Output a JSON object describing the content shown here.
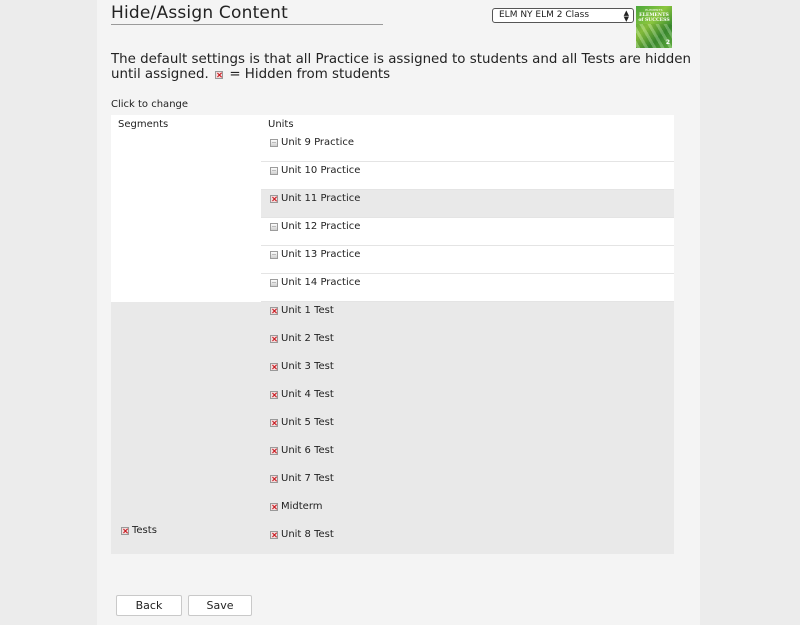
{
  "header": {
    "title": "Hide/Assign Content",
    "class_select": "ELM NY ELM 2 Class",
    "book_cover": {
      "top": "ELEMENTS",
      "title_line1": "ELEMENTS",
      "title_line2": "of SUCCESS",
      "number": "2"
    }
  },
  "description": {
    "text_before": "The default settings is that all Practice is assigned to students and all Tests are hidden until assigned.",
    "text_after": "= Hidden from students"
  },
  "hint": "Click to change",
  "table": {
    "col_segments": "Segments",
    "col_units": "Units",
    "practice_units": [
      {
        "label": "Unit 9 Practice",
        "hidden": false
      },
      {
        "label": "Unit 10 Practice",
        "hidden": false
      },
      {
        "label": "Unit 11 Practice",
        "hidden": true
      },
      {
        "label": "Unit 12 Practice",
        "hidden": false
      },
      {
        "label": "Unit 13 Practice",
        "hidden": false
      },
      {
        "label": "Unit 14 Practice",
        "hidden": false
      }
    ],
    "tests_segment": {
      "label": "Tests",
      "hidden": true
    },
    "test_units": [
      {
        "label": "Unit 1 Test",
        "hidden": true
      },
      {
        "label": "Unit 2 Test",
        "hidden": true
      },
      {
        "label": "Unit 3 Test",
        "hidden": true
      },
      {
        "label": "Unit 4 Test",
        "hidden": true
      },
      {
        "label": "Unit 5 Test",
        "hidden": true
      },
      {
        "label": "Unit 6 Test",
        "hidden": true
      },
      {
        "label": "Unit 7 Test",
        "hidden": true
      },
      {
        "label": "Midterm",
        "hidden": true
      },
      {
        "label": "Unit 8 Test",
        "hidden": true
      }
    ]
  },
  "buttons": {
    "back": "Back",
    "save": "Save"
  },
  "colors": {
    "hidden_icon": "#c8141b",
    "hidden_row_bg": "#e9e9e9",
    "page_bg": "#f4f4f4"
  },
  "icons": {
    "hidden": "hidden-x-icon",
    "shown": "visible-icon",
    "select": "dropdown-arrows-icon"
  }
}
